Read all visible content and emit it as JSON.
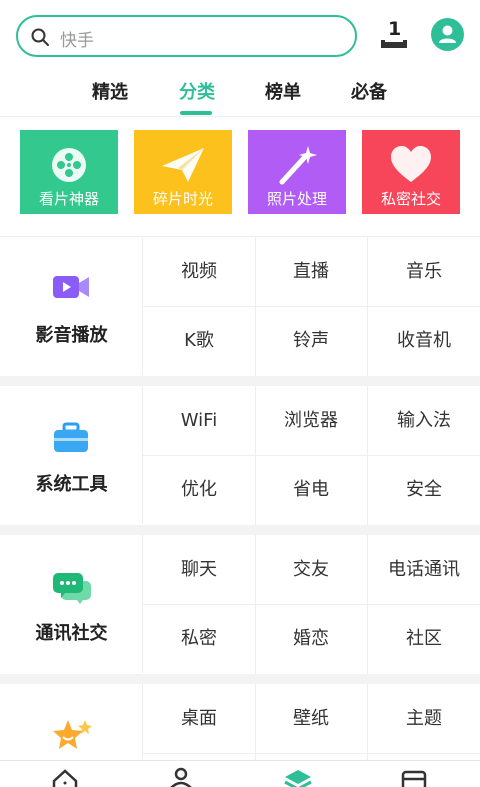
{
  "search": {
    "placeholder": "快手"
  },
  "download": {
    "count": "1"
  },
  "tabs": [
    {
      "label": "精选"
    },
    {
      "label": "分类"
    },
    {
      "label": "榜单"
    },
    {
      "label": "必备"
    }
  ],
  "active_tab": "分类",
  "accent_color": "#2ebf98",
  "banners": [
    {
      "label": "看片神器",
      "color": "#33c98e",
      "icon": "film-reel-icon"
    },
    {
      "label": "碎片时光",
      "color": "#fcc11d",
      "icon": "paper-plane-icon"
    },
    {
      "label": "照片处理",
      "color": "#b25cf6",
      "icon": "magic-wand-icon"
    },
    {
      "label": "私密社交",
      "color": "#f7465a",
      "icon": "heart-icon"
    }
  ],
  "sections": [
    {
      "title": "影音播放",
      "icon": "video-camera-icon",
      "items": [
        "视频",
        "直播",
        "音乐",
        "K歌",
        "铃声",
        "收音机"
      ]
    },
    {
      "title": "系统工具",
      "icon": "toolbox-icon",
      "items": [
        "WiFi",
        "浏览器",
        "输入法",
        "优化",
        "省电",
        "安全"
      ]
    },
    {
      "title": "通讯社交",
      "icon": "chat-bubbles-icon",
      "items": [
        "聊天",
        "交友",
        "电话通讯",
        "私密",
        "婚恋",
        "社区"
      ]
    },
    {
      "title": "",
      "icon": "star-icon",
      "items": [
        "桌面",
        "壁纸",
        "主题"
      ]
    }
  ],
  "bottom_nav": [
    {
      "icon": "home-icon"
    },
    {
      "icon": "user-icon"
    },
    {
      "icon": "category-stack-icon"
    },
    {
      "icon": "inbox-icon"
    }
  ]
}
